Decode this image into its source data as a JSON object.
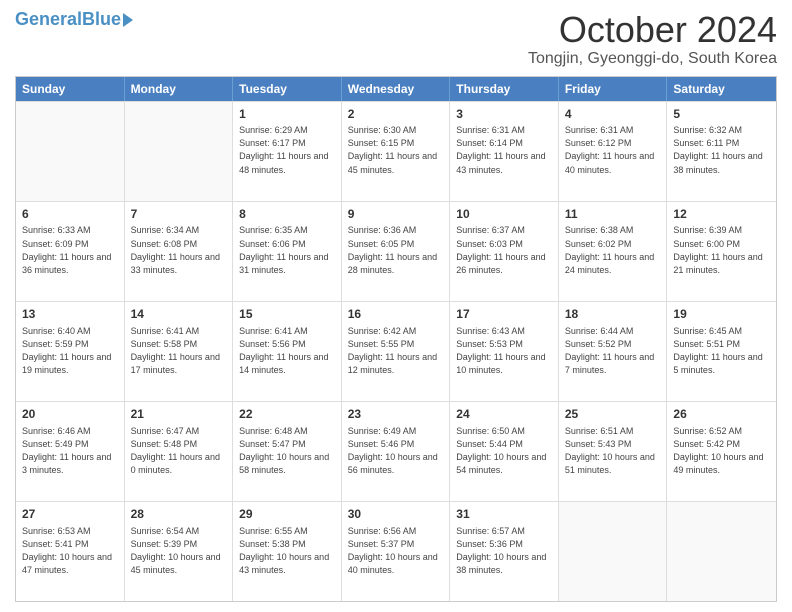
{
  "header": {
    "logo_general": "General",
    "logo_blue": "Blue",
    "main_title": "October 2024",
    "subtitle": "Tongjin, Gyeonggi-do, South Korea"
  },
  "days_of_week": [
    "Sunday",
    "Monday",
    "Tuesday",
    "Wednesday",
    "Thursday",
    "Friday",
    "Saturday"
  ],
  "weeks": [
    [
      {
        "day": "",
        "empty": true
      },
      {
        "day": "",
        "empty": true
      },
      {
        "day": "1",
        "sunrise": "6:29 AM",
        "sunset": "6:17 PM",
        "daylight": "11 hours and 48 minutes."
      },
      {
        "day": "2",
        "sunrise": "6:30 AM",
        "sunset": "6:15 PM",
        "daylight": "11 hours and 45 minutes."
      },
      {
        "day": "3",
        "sunrise": "6:31 AM",
        "sunset": "6:14 PM",
        "daylight": "11 hours and 43 minutes."
      },
      {
        "day": "4",
        "sunrise": "6:31 AM",
        "sunset": "6:12 PM",
        "daylight": "11 hours and 40 minutes."
      },
      {
        "day": "5",
        "sunrise": "6:32 AM",
        "sunset": "6:11 PM",
        "daylight": "11 hours and 38 minutes."
      }
    ],
    [
      {
        "day": "6",
        "sunrise": "6:33 AM",
        "sunset": "6:09 PM",
        "daylight": "11 hours and 36 minutes."
      },
      {
        "day": "7",
        "sunrise": "6:34 AM",
        "sunset": "6:08 PM",
        "daylight": "11 hours and 33 minutes."
      },
      {
        "day": "8",
        "sunrise": "6:35 AM",
        "sunset": "6:06 PM",
        "daylight": "11 hours and 31 minutes."
      },
      {
        "day": "9",
        "sunrise": "6:36 AM",
        "sunset": "6:05 PM",
        "daylight": "11 hours and 28 minutes."
      },
      {
        "day": "10",
        "sunrise": "6:37 AM",
        "sunset": "6:03 PM",
        "daylight": "11 hours and 26 minutes."
      },
      {
        "day": "11",
        "sunrise": "6:38 AM",
        "sunset": "6:02 PM",
        "daylight": "11 hours and 24 minutes."
      },
      {
        "day": "12",
        "sunrise": "6:39 AM",
        "sunset": "6:00 PM",
        "daylight": "11 hours and 21 minutes."
      }
    ],
    [
      {
        "day": "13",
        "sunrise": "6:40 AM",
        "sunset": "5:59 PM",
        "daylight": "11 hours and 19 minutes."
      },
      {
        "day": "14",
        "sunrise": "6:41 AM",
        "sunset": "5:58 PM",
        "daylight": "11 hours and 17 minutes."
      },
      {
        "day": "15",
        "sunrise": "6:41 AM",
        "sunset": "5:56 PM",
        "daylight": "11 hours and 14 minutes."
      },
      {
        "day": "16",
        "sunrise": "6:42 AM",
        "sunset": "5:55 PM",
        "daylight": "11 hours and 12 minutes."
      },
      {
        "day": "17",
        "sunrise": "6:43 AM",
        "sunset": "5:53 PM",
        "daylight": "11 hours and 10 minutes."
      },
      {
        "day": "18",
        "sunrise": "6:44 AM",
        "sunset": "5:52 PM",
        "daylight": "11 hours and 7 minutes."
      },
      {
        "day": "19",
        "sunrise": "6:45 AM",
        "sunset": "5:51 PM",
        "daylight": "11 hours and 5 minutes."
      }
    ],
    [
      {
        "day": "20",
        "sunrise": "6:46 AM",
        "sunset": "5:49 PM",
        "daylight": "11 hours and 3 minutes."
      },
      {
        "day": "21",
        "sunrise": "6:47 AM",
        "sunset": "5:48 PM",
        "daylight": "11 hours and 0 minutes."
      },
      {
        "day": "22",
        "sunrise": "6:48 AM",
        "sunset": "5:47 PM",
        "daylight": "10 hours and 58 minutes."
      },
      {
        "day": "23",
        "sunrise": "6:49 AM",
        "sunset": "5:46 PM",
        "daylight": "10 hours and 56 minutes."
      },
      {
        "day": "24",
        "sunrise": "6:50 AM",
        "sunset": "5:44 PM",
        "daylight": "10 hours and 54 minutes."
      },
      {
        "day": "25",
        "sunrise": "6:51 AM",
        "sunset": "5:43 PM",
        "daylight": "10 hours and 51 minutes."
      },
      {
        "day": "26",
        "sunrise": "6:52 AM",
        "sunset": "5:42 PM",
        "daylight": "10 hours and 49 minutes."
      }
    ],
    [
      {
        "day": "27",
        "sunrise": "6:53 AM",
        "sunset": "5:41 PM",
        "daylight": "10 hours and 47 minutes."
      },
      {
        "day": "28",
        "sunrise": "6:54 AM",
        "sunset": "5:39 PM",
        "daylight": "10 hours and 45 minutes."
      },
      {
        "day": "29",
        "sunrise": "6:55 AM",
        "sunset": "5:38 PM",
        "daylight": "10 hours and 43 minutes."
      },
      {
        "day": "30",
        "sunrise": "6:56 AM",
        "sunset": "5:37 PM",
        "daylight": "10 hours and 40 minutes."
      },
      {
        "day": "31",
        "sunrise": "6:57 AM",
        "sunset": "5:36 PM",
        "daylight": "10 hours and 38 minutes."
      },
      {
        "day": "",
        "empty": true
      },
      {
        "day": "",
        "empty": true
      }
    ]
  ],
  "labels": {
    "sunrise": "Sunrise:",
    "sunset": "Sunset:",
    "daylight": "Daylight:"
  }
}
